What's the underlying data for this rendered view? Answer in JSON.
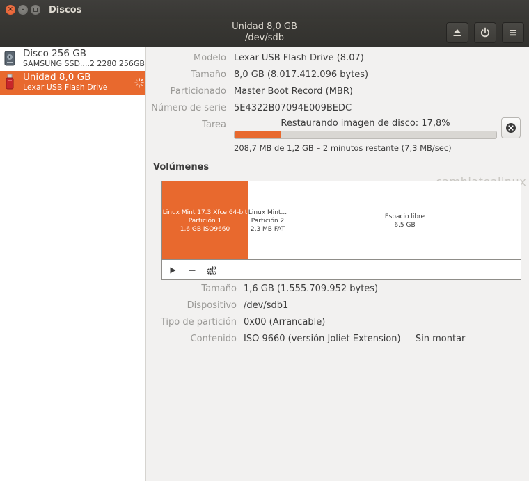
{
  "window": {
    "title": "Discos",
    "header_title": "Unidad 8,0 GB",
    "header_subtitle": "/dev/sdb"
  },
  "toolbar": {
    "eject_icon": "eject-icon",
    "power_icon": "power-icon",
    "menu_icon": "hamburger-menu-icon"
  },
  "sidebar": {
    "drives": [
      {
        "name": "Disco 256 GB",
        "subtitle": "SAMSUNG SSD....2 2280 256GB",
        "icon": "hard-disk-icon",
        "selected": false
      },
      {
        "name": "Unidad 8,0 GB",
        "subtitle": "Lexar USB Flash Drive",
        "icon": "usb-drive-icon",
        "selected": true
      }
    ]
  },
  "drive_info": {
    "model_label": "Modelo",
    "model_value": "Lexar USB Flash Drive (8.07)",
    "size_label": "Tamaño",
    "size_value": "8,0 GB (8.017.412.096 bytes)",
    "partitioning_label": "Particionado",
    "partitioning_value": "Master Boot Record (MBR)",
    "serial_label": "Número de serie",
    "serial_value": "5E4322B07094E009BEDC",
    "task_label": "Tarea",
    "task_value": "Restaurando imagen de disco: 17,8%",
    "task_progress": 0.178,
    "task_detail": "208,7 MB de 1,2 GB – 2 minutos restante (7,3 MB/sec)"
  },
  "volumes": {
    "section_title": "Volúmenes",
    "watermark": "cambiatealinux",
    "segments": [
      {
        "line1": "Linux Mint 17.3 Xfce 64-bit",
        "line2": "Partición 1",
        "line3": "1,6 GB ISO9660",
        "selected": true
      },
      {
        "line1": "Linux Mint...",
        "line2": "Partición 2",
        "line3": "2,3 MB FAT",
        "selected": false
      },
      {
        "line1": "Espacio libre",
        "line2": "6,5 GB"
      }
    ]
  },
  "partition_info": {
    "size_label": "Tamaño",
    "size_value": "1,6 GB (1.555.709.952 bytes)",
    "device_label": "Dispositivo",
    "device_value": "/dev/sdb1",
    "type_label": "Tipo de partición",
    "type_value": "0x00 (Arrancable)",
    "content_label": "Contenido",
    "content_value": "ISO 9660 (versión Joliet Extension) — Sin montar"
  },
  "colors": {
    "accent": "#e8692e",
    "titlebar": "#3c3b37"
  }
}
